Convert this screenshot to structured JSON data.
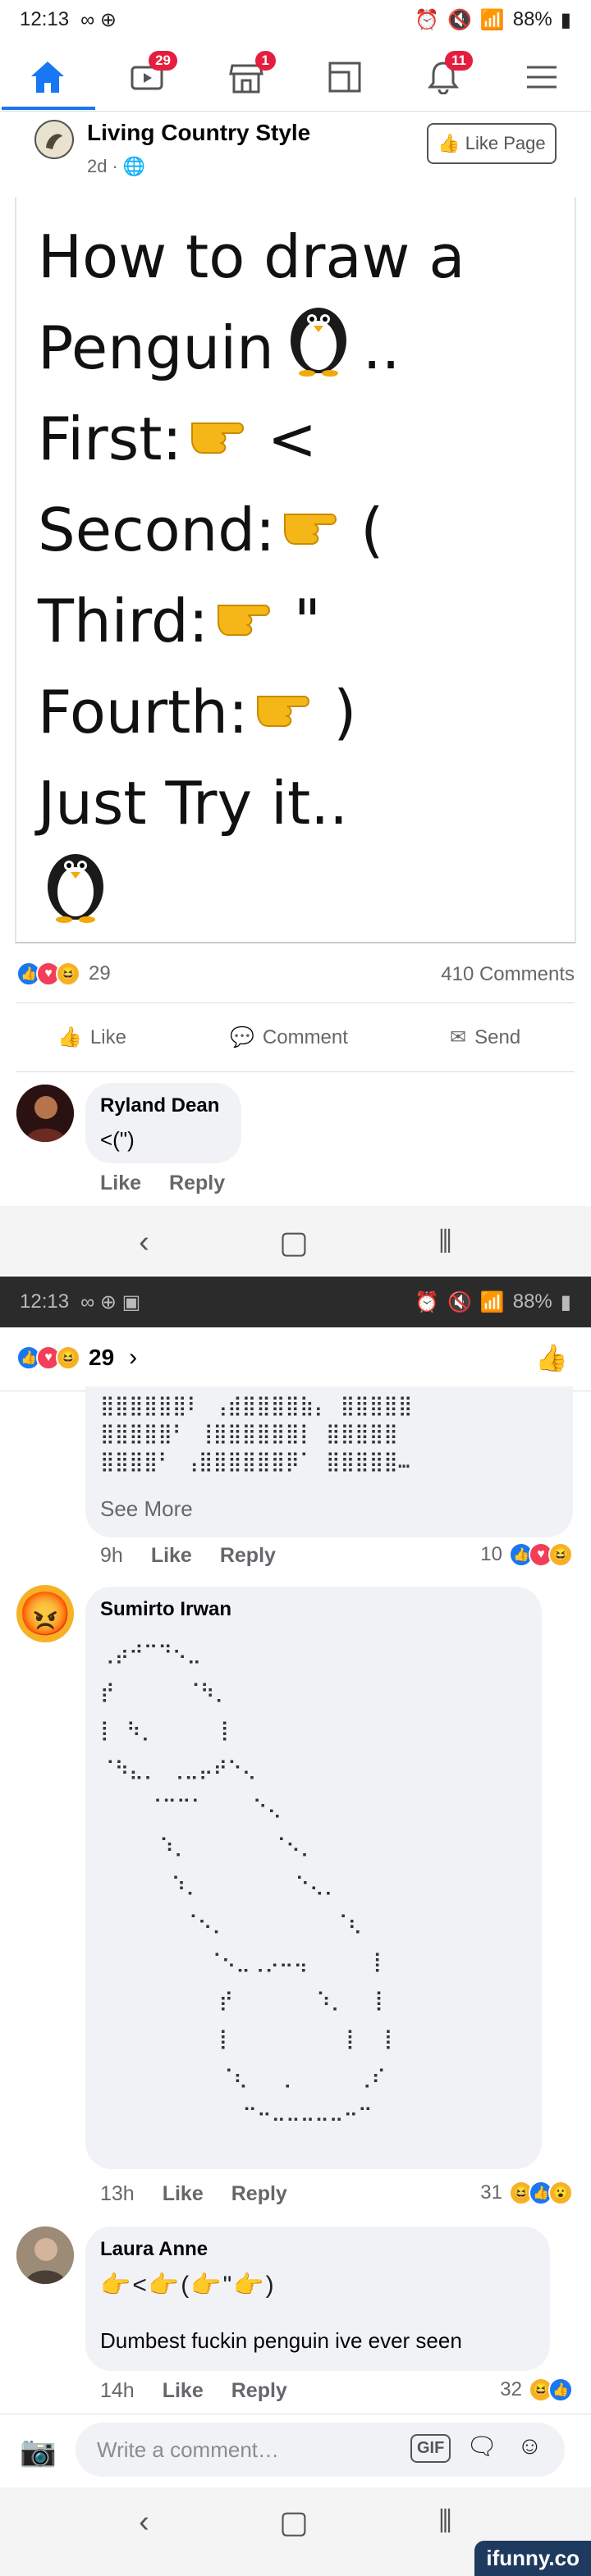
{
  "status_bar": {
    "time": "12:13",
    "battery": "88%",
    "time_2": "12:13",
    "battery_2": "88%"
  },
  "nav": {
    "badges": {
      "video": "29",
      "marketplace": "1",
      "notifications": "11"
    }
  },
  "post": {
    "page_name": "Living Country Style",
    "post_time": "2d",
    "like_page_label": "Like Page",
    "lines": {
      "l1": "How to draw a",
      "l2": "Penguin",
      "l2_suffix": "..",
      "l3": "First:",
      "l3_char": "<",
      "l4": "Second:",
      "l4_char": "(",
      "l5": "Third:",
      "l5_char": "\"",
      "l6": "Fourth:",
      "l6_char": ")",
      "l7": "Just Try it.."
    },
    "reaction_count": "29",
    "comments_count": "410 Comments",
    "actions": {
      "like": "Like",
      "comment": "Comment",
      "send": "Send"
    }
  },
  "comments_preview": {
    "c1": {
      "name": "Ryland Dean",
      "text": "<(\")",
      "like": "Like",
      "reply": "Reply"
    }
  },
  "comments_screen": {
    "reaction_count": "29",
    "ascii_block": "⣿⣿⣿⣿⣿⣿⠇ ⢠⣾⣿⣿⣿⣿⣷⡄ ⣿⣿⣿⣿⣿\n⣿⣿⣿⣿⣿⠃ ⢸⣿⣿⣿⣿⣿⣿⡇ ⣿⣿⣿⣿⣿\n⣿⣿⣿⣿⠃ ⢠⣿⣿⣿⣿⣿⣿⡿⠁ ⣿⣿⣿⣿⣿…",
    "see_more": "See More",
    "c2_time": "9h",
    "c2_like": "Like",
    "c2_reply": "Reply",
    "c2_count": "10",
    "c3": {
      "name": "Sumirto Irwan",
      "art": "⢀⡴⠚⠉⠙⠢⣀\n⡞      ⠈⠳⡀\n⡇ ⠳⡀     ⢸\n⠈⠳⣄⡀ ⢀⣀⡤⠞⠑⢄\n    ⠈⠉⠉⠁    ⠑⢄\n     ⠱⡀       ⠈⠢⡀\n      ⠱⡀        ⠑⢄⡀\n       ⠈⠢⡀         ⠈⢆\n         ⠈⠢⣀⢀⡠⠤⢤     ⢸\n          ⡞       ⠱⡀  ⢸\n          ⡇         ⢸  ⢸\n          ⠈⢆   ⡀     ⢀⠎\n            ⠉⠒⠤⠤⠤⠤⠤⠒⠉",
      "time": "13h",
      "like": "Like",
      "reply": "Reply",
      "count": "31"
    },
    "c4": {
      "name": "Laura Anne",
      "text": "Dumbest fuckin penguin ive ever seen",
      "time": "14h",
      "like": "Like",
      "reply": "Reply",
      "count": "32"
    },
    "input_placeholder": "Write a comment…",
    "gif_label": "GIF"
  },
  "watermark": "ifunny.co"
}
